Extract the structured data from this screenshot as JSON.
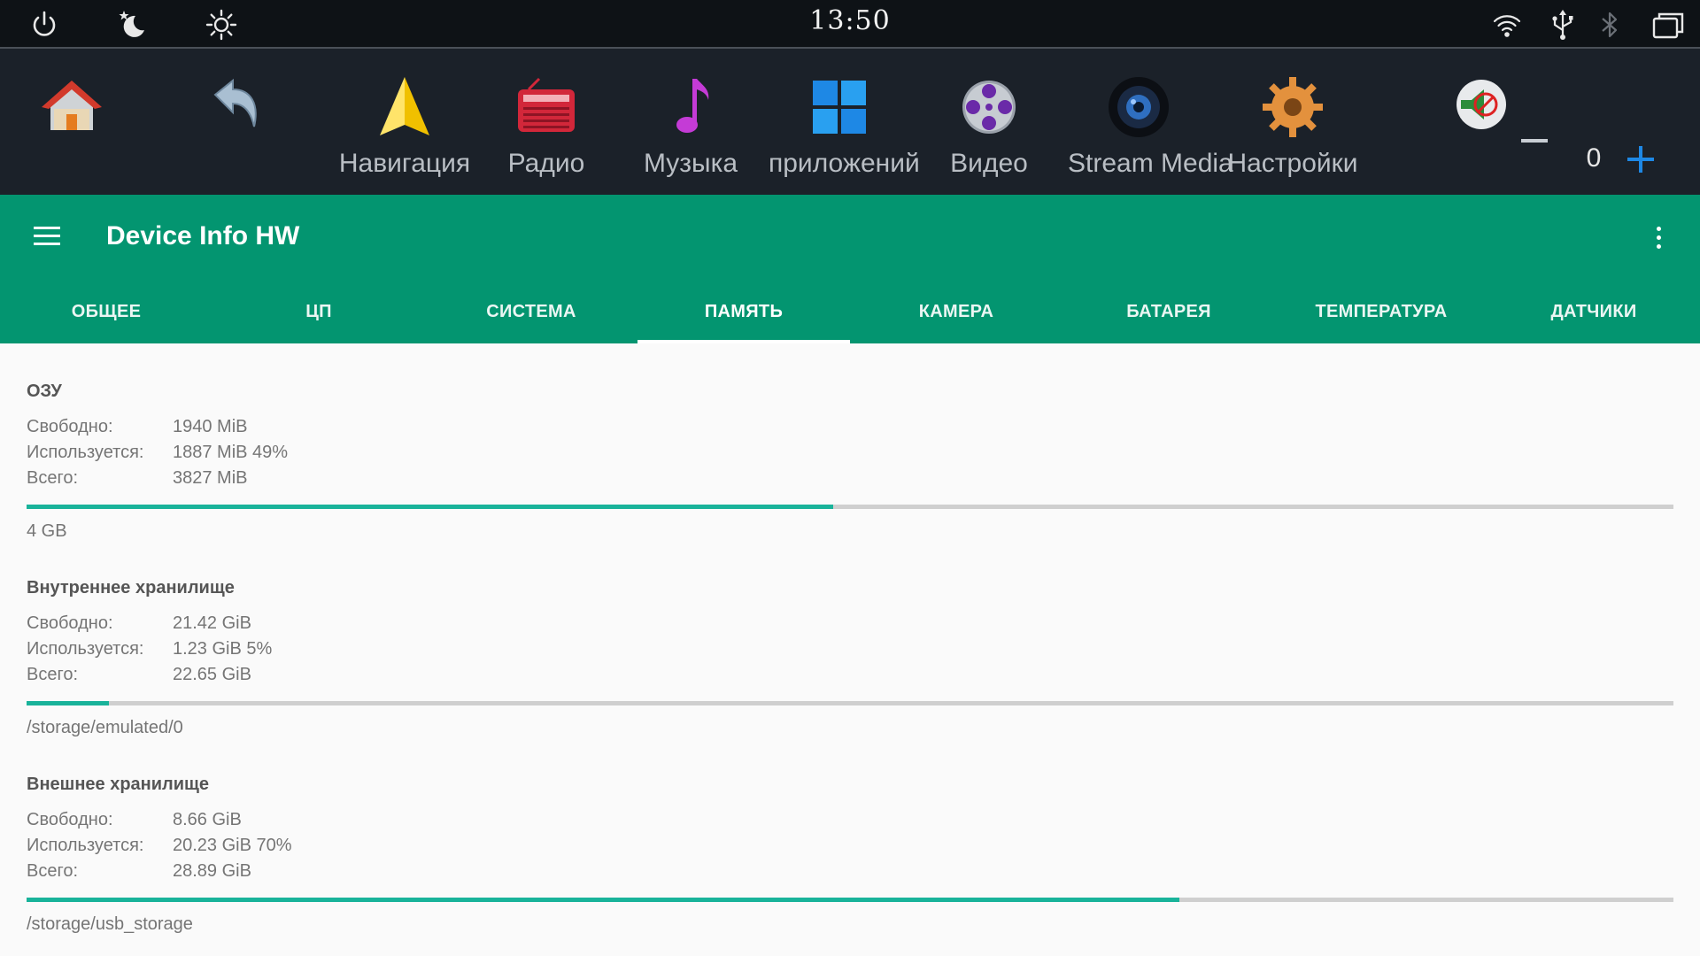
{
  "status_bar": {
    "time": "13:50",
    "icons": [
      "power-icon",
      "night-mode-icon",
      "brightness-icon",
      "wifi-icon",
      "usb-icon",
      "bluetooth-icon",
      "recent-apps-icon"
    ]
  },
  "launcher": {
    "apps": [
      {
        "name": "home",
        "label": ""
      },
      {
        "name": "back",
        "label": ""
      },
      {
        "name": "navigation",
        "label": "Навигация"
      },
      {
        "name": "radio",
        "label": "Радио"
      },
      {
        "name": "music",
        "label": "Музыка"
      },
      {
        "name": "apps",
        "label": "приложений"
      },
      {
        "name": "video",
        "label": "Видео"
      },
      {
        "name": "stream-media",
        "label": "Stream Media"
      },
      {
        "name": "settings",
        "label": "Настройки"
      }
    ],
    "volume": {
      "value": "0"
    }
  },
  "appbar": {
    "title": "Device Info HW",
    "tabs": [
      "ОБЩЕЕ",
      "ЦП",
      "СИСТЕМА",
      "ПАМЯТЬ",
      "КАМЕРА",
      "БАТАРЕЯ",
      "ТЕМПЕРАТУРА",
      "ДАТЧИКИ"
    ],
    "active_tab": "ПАМЯТЬ"
  },
  "memory": {
    "labels": {
      "free": "Свободно:",
      "used": "Используется:",
      "total": "Всего:"
    },
    "ram": {
      "title": "ОЗУ",
      "free": "1940 MiB",
      "used": "1887 MiB 49%",
      "total": "3827 MiB",
      "used_fraction": 0.49,
      "footer": "4 GB"
    },
    "internal": {
      "title": "Внутреннее хранилище",
      "free": "21.42 GiB",
      "used": "1.23 GiB 5%",
      "total": "22.65 GiB",
      "used_fraction": 0.05,
      "footer": "/storage/emulated/0"
    },
    "external": {
      "title": "Внешнее хранилище",
      "free": "8.66 GiB",
      "used": "20.23 GiB 70%",
      "total": "28.89 GiB",
      "used_fraction": 0.7,
      "footer": "/storage/usb_storage"
    }
  },
  "colors": {
    "accent": "#039570",
    "progress": "#19b39a",
    "track": "#cfcfcf"
  }
}
